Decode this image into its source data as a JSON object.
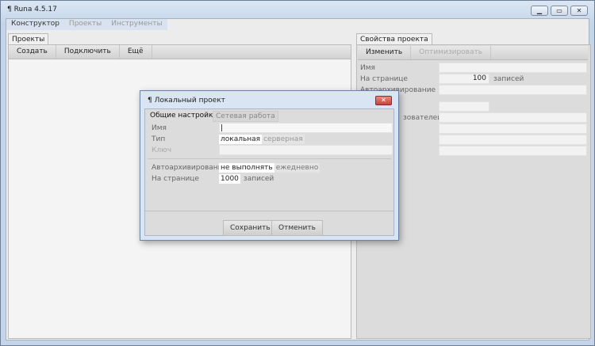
{
  "window": {
    "title": "Runa 4.5.17",
    "icon": "runa-icon"
  },
  "menu": [
    "Конструктор",
    "Проекты",
    "Инструменты"
  ],
  "left": {
    "tab": "Проекты",
    "toolbar": [
      "Создать",
      "Подключить",
      "Ещё"
    ]
  },
  "right": {
    "tab": "Свойства проекта",
    "toolbar": {
      "edit": "Изменить",
      "optimize": "Оптимизировать"
    },
    "name_label": "Имя",
    "per_page_label": "На странице",
    "per_page_value": "100",
    "per_page_unit": "записей",
    "autoarchive_label": "Автоархивирование",
    "users_label_partial": "зователей"
  },
  "dialog": {
    "title": "Локальный проект",
    "tabs": [
      "Общие настройки",
      "Сетевая работа"
    ],
    "name_label": "Имя",
    "name_value": "",
    "type_label": "Тип",
    "type_options": [
      "локальная",
      "серверная"
    ],
    "key_label": "Ключ",
    "autoarchive_label": "Автоархивирование",
    "autoarchive_options": [
      "не выполнять",
      "ежедневно"
    ],
    "per_page_label": "На странице",
    "per_page_value": "1000",
    "per_page_unit": "записей",
    "save": "Сохранить",
    "cancel": "Отменить"
  }
}
